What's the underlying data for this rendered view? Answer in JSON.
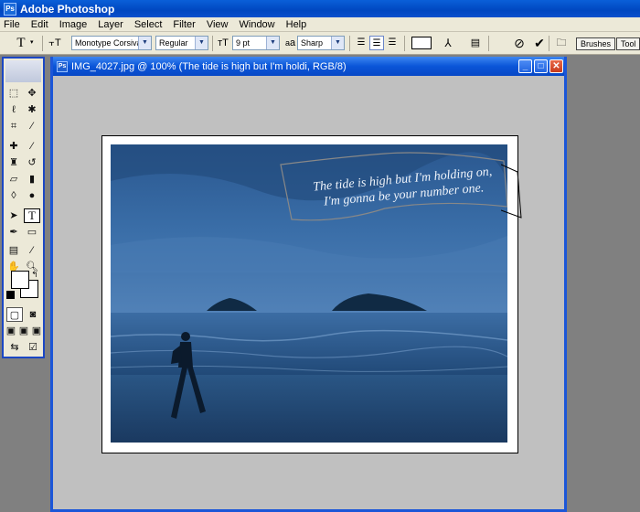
{
  "app": {
    "title": "Adobe Photoshop"
  },
  "menu": [
    "File",
    "Edit",
    "Image",
    "Layer",
    "Select",
    "Filter",
    "View",
    "Window",
    "Help"
  ],
  "options": {
    "font_family": "Monotype Corsiva",
    "font_style": "Regular",
    "font_size": "9 pt",
    "antialias_label": "a",
    "antialias": "Sharp",
    "brushes_tab": "Brushes",
    "tool_presets_tab": "Tool P"
  },
  "document": {
    "title": "IMG_4027.jpg @ 100% (The tide is high but I'm holdi, RGB/8)",
    "minimize": "_",
    "maximize": "□",
    "close": "✕",
    "text_layer": [
      "The tide is high but I'm holding on,",
      "I'm gonna be your number one."
    ]
  },
  "colors": {
    "titlebar": "#0047c0",
    "chrome": "#ece9d8",
    "workspace": "#808080",
    "doc_bg": "#c0c0c0",
    "sky": "#3b6fa6",
    "sea": "#2e5c8a"
  },
  "icons": {
    "move": "move-icon",
    "marquee": "marquee-icon",
    "lasso": "lasso-icon",
    "magic-wand": "magic-wand-icon",
    "crop": "crop-icon",
    "slice": "slice-icon",
    "healing": "healing-icon",
    "brush": "brush-icon",
    "stamp": "stamp-icon",
    "history-brush": "history-brush-icon",
    "eraser": "eraser-icon",
    "gradient": "gradient-icon",
    "blur": "blur-icon",
    "dodge": "dodge-icon",
    "path-select": "path-select-icon",
    "type": "type-icon",
    "pen": "pen-icon",
    "shape": "shape-icon",
    "notes": "notes-icon",
    "eyedropper": "eyedropper-icon",
    "hand": "hand-icon",
    "zoom": "zoom-icon"
  }
}
